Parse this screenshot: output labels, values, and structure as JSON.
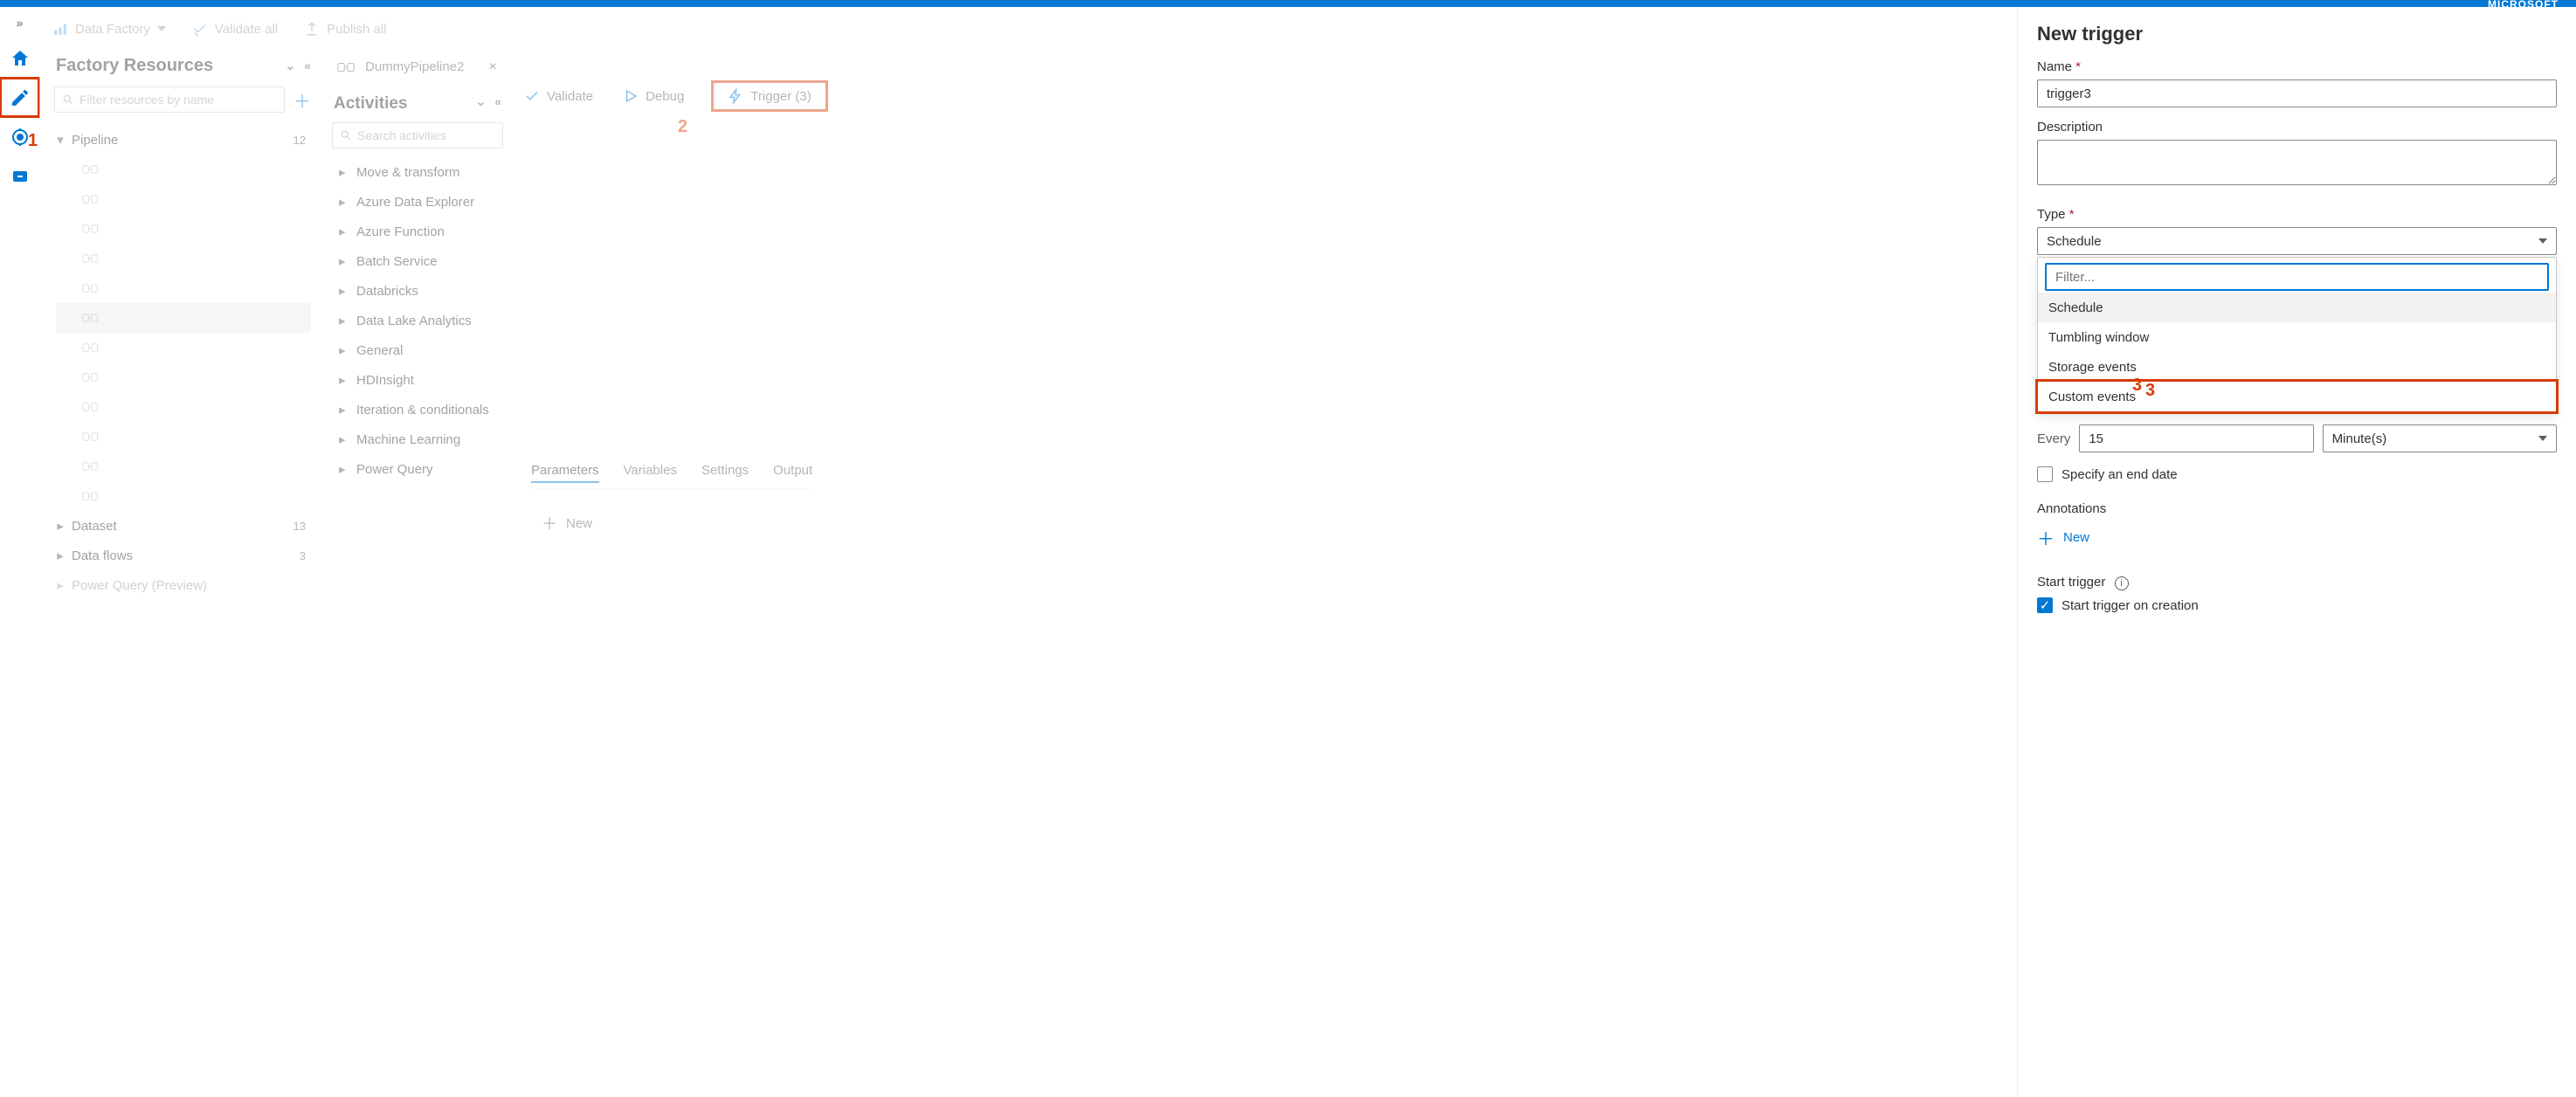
{
  "brand": "MICROSOFT",
  "toolbar": {
    "data_factory": "Data Factory",
    "validate_all": "Validate all",
    "publish_all": "Publish all"
  },
  "leftnav": {
    "items": [
      "home-icon",
      "author-icon",
      "monitor-icon",
      "manage-icon"
    ],
    "annot1": "1"
  },
  "factory": {
    "title": "Factory Resources",
    "filter_placeholder": "Filter resources by name",
    "sections": [
      {
        "name": "Pipeline",
        "count": 12,
        "expanded": true,
        "items": [
          "",
          "",
          "",
          "",
          "",
          "",
          "",
          "",
          "",
          "",
          "",
          ""
        ]
      },
      {
        "name": "Dataset",
        "count": 13,
        "expanded": false
      },
      {
        "name": "Data flows",
        "count": 3,
        "expanded": false
      },
      {
        "name": "Power Query (Preview)",
        "count": "",
        "expanded": false
      }
    ]
  },
  "tab": {
    "label": "DummyPipeline2"
  },
  "activities": {
    "title": "Activities",
    "search_placeholder": "Search activities",
    "groups": [
      "Move & transform",
      "Azure Data Explorer",
      "Azure Function",
      "Batch Service",
      "Databricks",
      "Data Lake Analytics",
      "General",
      "HDInsight",
      "Iteration & conditionals",
      "Machine Learning",
      "Power Query"
    ]
  },
  "canvas_toolbar": {
    "validate": "Validate",
    "debug": "Debug",
    "trigger": "Trigger (3)",
    "annot2": "2"
  },
  "canvas_tabs": [
    "Parameters",
    "Variables",
    "Settings",
    "Output"
  ],
  "canvas_new": "New",
  "panel": {
    "title": "New trigger",
    "name_label": "Name",
    "name_value": "trigger3",
    "desc_label": "Description",
    "type_label": "Type",
    "type_value": "Schedule",
    "filter_placeholder": "Filter...",
    "options": [
      "Schedule",
      "Tumbling window",
      "Storage events",
      "Custom events"
    ],
    "annot3": "3",
    "every_label": "Every",
    "every_value": "15",
    "every_unit": "Minute(s)",
    "specify_end": "Specify an end date",
    "annotations_label": "Annotations",
    "new_label": "New",
    "start_trigger_label": "Start trigger",
    "start_trigger_chk": "Start trigger on creation"
  }
}
